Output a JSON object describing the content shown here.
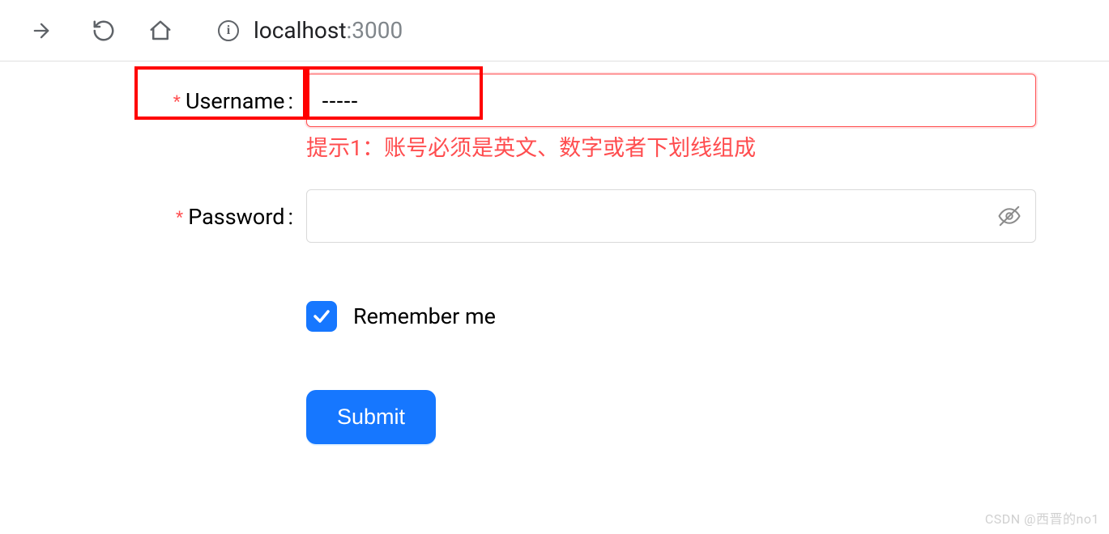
{
  "browser": {
    "url_host": "localhost",
    "url_port": ":3000"
  },
  "form": {
    "username": {
      "label": "Username",
      "value": "-----",
      "error": "提示1：账号必须是英文、数字或者下划线组成"
    },
    "password": {
      "label": "Password",
      "value": ""
    },
    "remember": {
      "label": "Remember me",
      "checked": true
    },
    "submit_label": "Submit"
  },
  "watermark": "CSDN @西晋的no1"
}
